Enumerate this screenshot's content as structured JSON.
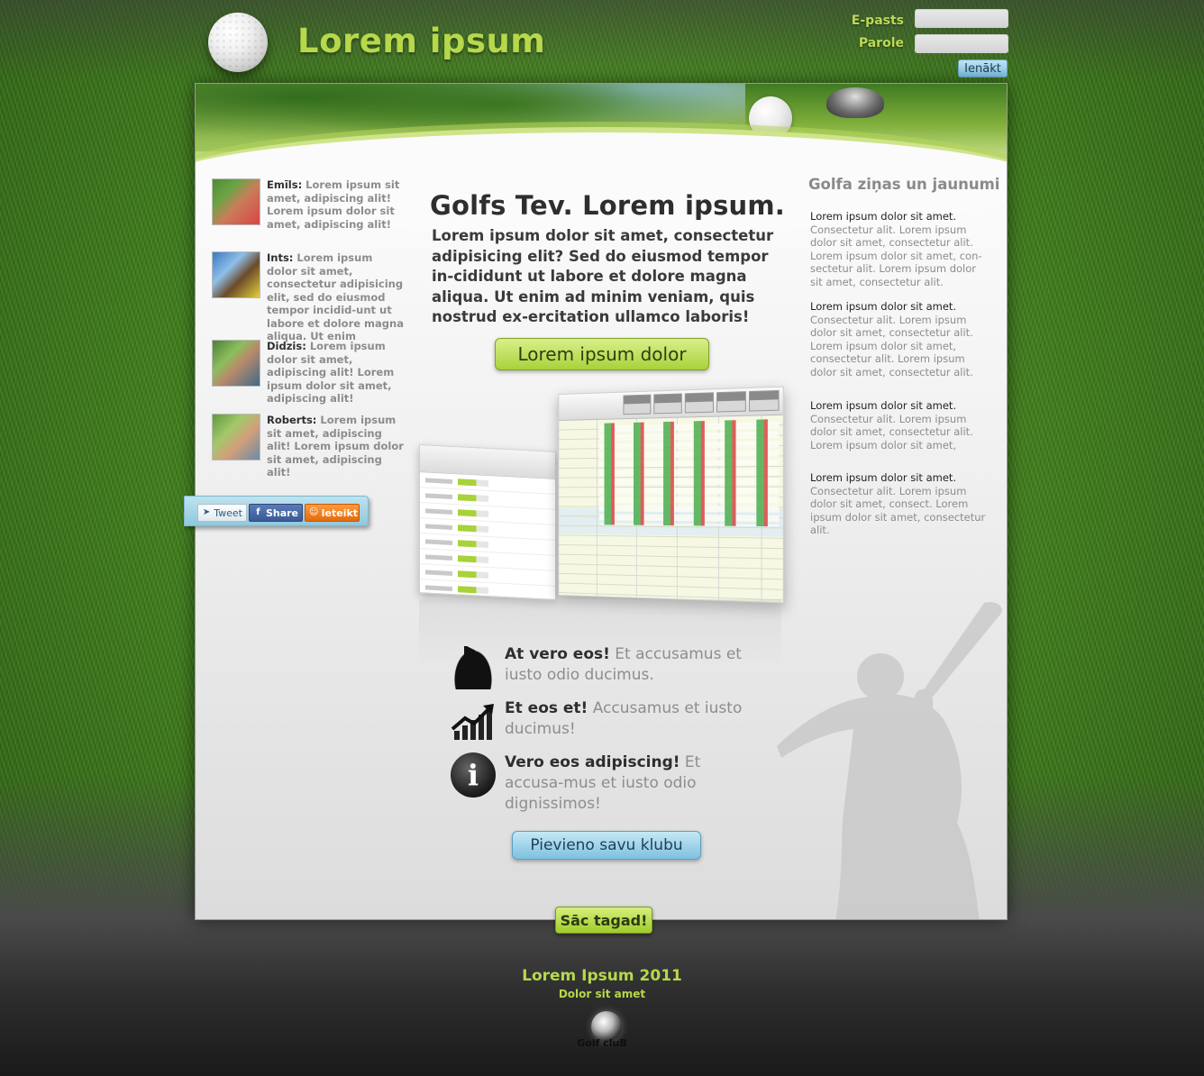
{
  "header": {
    "site_title": "Lorem ipsum",
    "login": {
      "email_label": "E-pasts",
      "password_label": "Parole",
      "email_value": "",
      "password_value": "",
      "login_button": "Ienākt"
    }
  },
  "testimonials": [
    {
      "name": "Emīls:",
      "text": " Lorem ipsum sit amet, adipiscing alit! Lorem ipsum dolor sit amet, adipiscing alit!"
    },
    {
      "name": "Ints:",
      "text": " Lorem ipsum dolor sit amet, consectetur adipisicing elit, sed do eiusmod tempor incidid-unt ut labore et dolore magna aliqua. Ut enim"
    },
    {
      "name": "Didzis:",
      "text": " Lorem ipsum dolor sit amet, adipiscing alit! Lorem ipsum dolor sit amet, adipiscing alit!"
    },
    {
      "name": "Roberts:",
      "text": " Lorem ipsum sit amet, adipiscing alit! Lorem ipsum dolor sit amet, adipiscing alit!"
    }
  ],
  "social": {
    "tweet": "Tweet",
    "share": "Share",
    "recommend": "Ieteikt"
  },
  "main": {
    "headline": "Golfs Tev. Lorem ipsum.",
    "intro": "Lorem ipsum dolor sit amet, consectetur adipisicing elit? Sed do eiusmod tempor in-cididunt ut labore et dolore magna aliqua. Ut enim ad minim veniam, quis nostrud ex-ercitation ullamco laboris!",
    "cta_button": "Lorem ipsum dolor",
    "features": [
      {
        "icon": "golf-flag-icon",
        "bold": "At vero eos!",
        "text": " Et accusamus et iusto odio ducimus."
      },
      {
        "icon": "growth-chart-icon",
        "bold": "Et eos et!",
        "text": " Accusamus et iusto ducimus!"
      },
      {
        "icon": "info-icon",
        "bold": "Vero eos adipiscing!",
        "text": " Et accusa-mus et iusto odio dignissimos!"
      }
    ],
    "add_club_button": "Pievieno savu klubu",
    "start_button": "Sāc tagad!"
  },
  "news": {
    "title": "Golfa ziņas un jaunumi",
    "items": [
      {
        "lead": "Lorem ipsum dolor sit amet.",
        "text": " Consectetur alit. Lorem ipsum dolor sit amet, consectetur alit. Lorem ipsum dolor sit amet, con-sectetur alit. Lorem ipsum dolor sit amet, consectetur alit."
      },
      {
        "lead": "Lorem ipsum dolor sit amet.",
        "text": " Consectetur alit. Lorem ipsum dolor sit amet, consectetur alit. Lorem ipsum dolor sit amet, consectetur alit. Lorem ipsum dolor sit amet, consectetur alit."
      },
      {
        "lead": "Lorem ipsum dolor sit amet.",
        "text": " Consectetur alit. Lorem ipsum dolor sit amet, consectetur alit. Lorem ipsum dolor sit amet,"
      },
      {
        "lead": "Lorem ipsum dolor sit amet.",
        "text": " Consectetur alit. Lorem ipsum dolor sit amet, consect. Lorem ipsum dolor sit amet, consectetur alit."
      }
    ]
  },
  "footer": {
    "title": "Lorem Ipsum 2011",
    "subtitle": "Dolor sit amet",
    "logo_text": "Golf cluB"
  },
  "colors": {
    "accent_green": "#b6d84a",
    "button_blue": "#7fc1de",
    "text_dark": "#2e2e2e",
    "text_gray": "#8c8c8c"
  }
}
